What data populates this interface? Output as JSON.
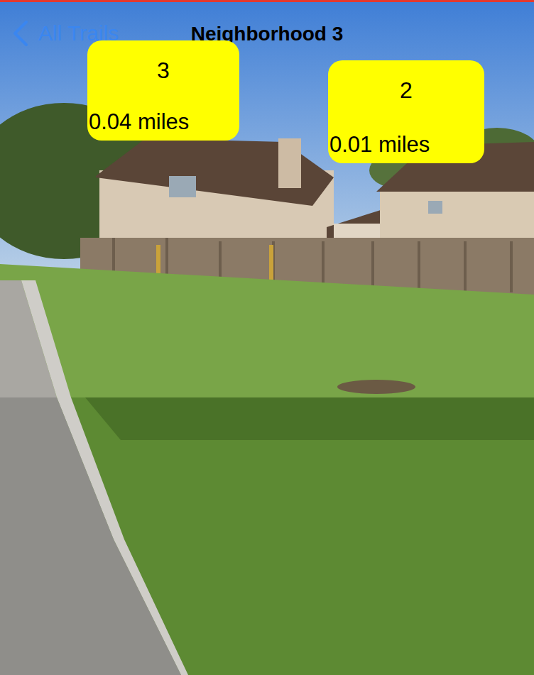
{
  "nav": {
    "back": "All Trails",
    "title": "Neighborhood 3"
  },
  "markers": [
    {
      "number": "3",
      "distance": "0.04 miles"
    },
    {
      "number": "2",
      "distance": "0.01 miles"
    }
  ]
}
